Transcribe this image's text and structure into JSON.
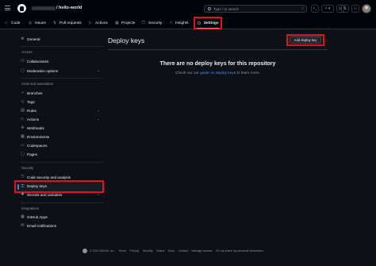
{
  "header": {
    "repo_name": "/ hello-world",
    "search_placeholder": "Type / to search",
    "command_palette_glyph": ">_",
    "create_label": "+ ▾"
  },
  "repo_nav": {
    "tabs": [
      {
        "label": "Code",
        "icon": "code-icon"
      },
      {
        "label": "Issues",
        "icon": "issue-icon"
      },
      {
        "label": "Pull requests",
        "icon": "pull-request-icon"
      },
      {
        "label": "Actions",
        "icon": "play-icon"
      },
      {
        "label": "Projects",
        "icon": "table-icon"
      },
      {
        "label": "Security",
        "icon": "shield-icon"
      },
      {
        "label": "Insights",
        "icon": "graph-icon"
      }
    ],
    "settings_label": "Settings"
  },
  "sidebar": {
    "general": "General",
    "access_heading": "Access",
    "collaborators": "Collaborators",
    "moderation": "Moderation options",
    "code_heading": "Code and automation",
    "branches": "Branches",
    "tags": "Tags",
    "rules": "Rules",
    "actions": "Actions",
    "webhooks": "Webhooks",
    "environments": "Environments",
    "codespaces": "Codespaces",
    "pages": "Pages",
    "security_heading": "Security",
    "code_security": "Code security and analysis",
    "deploy_keys": "Deploy keys",
    "secrets": "Secrets and variables",
    "integrations_heading": "Integrations",
    "github_apps": "GitHub Apps",
    "email_notifications": "Email notifications"
  },
  "main": {
    "title": "Deploy keys",
    "add_button": "Add deploy key",
    "empty_title": "There are no deploy keys for this repository",
    "empty_prefix": "Check out our ",
    "empty_link": "guide on deploy keys",
    "empty_suffix": " to learn more."
  },
  "footer": {
    "copyright": "© 2024 GitHub, Inc.",
    "links": [
      "Terms",
      "Privacy",
      "Security",
      "Status",
      "Docs",
      "Contact",
      "Manage cookies",
      "Do not share my personal information"
    ]
  },
  "colors": {
    "highlight": "#e3101d",
    "background": "#0d1117",
    "link": "#4493f8"
  }
}
